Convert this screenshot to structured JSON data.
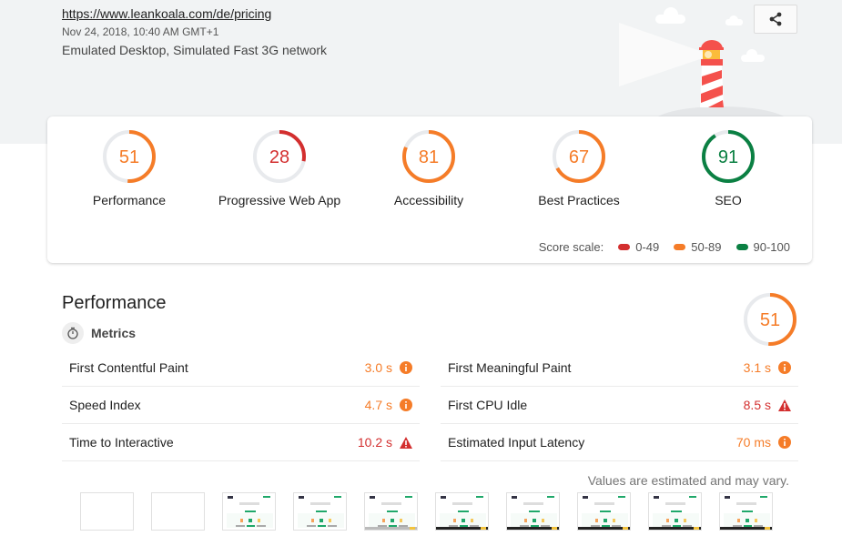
{
  "header": {
    "url": "https://www.leankoala.com/de/pricing",
    "timestamp": "Nov 24, 2018, 10:40 AM GMT+1",
    "environment": "Emulated Desktop, Simulated Fast 3G network",
    "share_icon": "share-icon"
  },
  "colors": {
    "fail": "#d32f2f",
    "average": "#f57c28",
    "pass": "#0b8043",
    "track": "#e8eaed"
  },
  "scores": [
    {
      "label": "Performance",
      "value": 51,
      "rating": "average"
    },
    {
      "label": "Progressive Web App",
      "value": 28,
      "rating": "fail"
    },
    {
      "label": "Accessibility",
      "value": 81,
      "rating": "average"
    },
    {
      "label": "Best Practices",
      "value": 67,
      "rating": "average"
    },
    {
      "label": "SEO",
      "value": 91,
      "rating": "pass"
    }
  ],
  "score_scale": {
    "label": "Score scale:",
    "ranges": [
      {
        "label": "0-49",
        "rating": "fail"
      },
      {
        "label": "50-89",
        "rating": "average"
      },
      {
        "label": "90-100",
        "rating": "pass"
      }
    ]
  },
  "performance": {
    "title": "Performance",
    "score": 51,
    "rating": "average",
    "metrics_label": "Metrics",
    "metrics_left": [
      {
        "name": "First Contentful Paint",
        "value": "3.0 s",
        "rating": "average",
        "icon": "info-icon"
      },
      {
        "name": "Speed Index",
        "value": "4.7 s",
        "rating": "average",
        "icon": "info-icon"
      },
      {
        "name": "Time to Interactive",
        "value": "10.2 s",
        "rating": "fail",
        "icon": "warning-icon"
      }
    ],
    "metrics_right": [
      {
        "name": "First Meaningful Paint",
        "value": "3.1 s",
        "rating": "average",
        "icon": "info-icon"
      },
      {
        "name": "First CPU Idle",
        "value": "8.5 s",
        "rating": "fail",
        "icon": "warning-icon"
      },
      {
        "name": "Estimated Input Latency",
        "value": "70 ms",
        "rating": "average",
        "icon": "info-icon"
      }
    ],
    "footnote": "Values are estimated and may vary.",
    "filmstrip": [
      {
        "state": "blank"
      },
      {
        "state": "blank"
      },
      {
        "state": "loaded"
      },
      {
        "state": "loaded"
      },
      {
        "state": "loaded-bar"
      },
      {
        "state": "loaded-bar"
      },
      {
        "state": "loaded-bar"
      },
      {
        "state": "loaded-bar"
      },
      {
        "state": "loaded-bar"
      },
      {
        "state": "loaded-bar"
      }
    ]
  }
}
